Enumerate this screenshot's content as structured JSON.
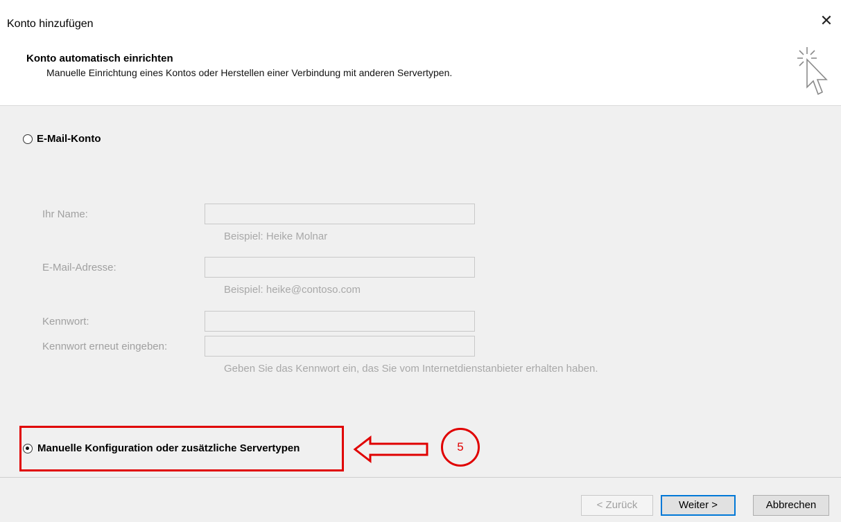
{
  "window": {
    "title": "Konto hinzufügen",
    "close_icon": "close-icon"
  },
  "header": {
    "title": "Konto automatisch einrichten",
    "subtitle": "Manuelle Einrichtung eines Kontos oder Herstellen einer Verbindung mit anderen Servertypen.",
    "icon": "cursor-sparkle-icon"
  },
  "options": {
    "email_account": {
      "label": "E-Mail-Konto",
      "selected": false
    },
    "manual": {
      "label": "Manuelle Konfiguration oder zusätzliche Servertypen",
      "selected": true
    }
  },
  "form": {
    "name_label": "Ihr Name:",
    "name_value": "",
    "name_hint": "Beispiel: Heike Molnar",
    "email_label": "E-Mail-Adresse:",
    "email_value": "",
    "email_hint": "Beispiel: heike@contoso.com",
    "password_label": "Kennwort:",
    "password_value": "",
    "password_repeat_label": "Kennwort erneut eingeben:",
    "password_repeat_value": "",
    "password_hint": "Geben Sie das Kennwort ein, das Sie vom Internetdienstanbieter erhalten haben."
  },
  "annotation": {
    "step_number": "5",
    "color": "#e00000"
  },
  "buttons": {
    "back": "< Zurück",
    "next": "Weiter >",
    "cancel": "Abbrechen"
  },
  "colors": {
    "accent": "#0078d7",
    "disabled_text": "#a0a0a0",
    "panel_bg": "#f0f0f0"
  }
}
